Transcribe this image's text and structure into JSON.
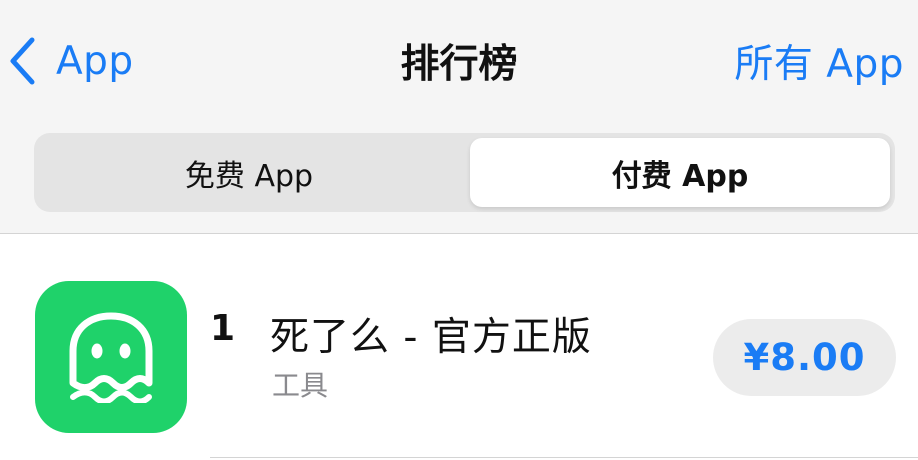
{
  "nav": {
    "back_label": "App",
    "title": "排行榜",
    "right_label": "所有 App"
  },
  "segments": {
    "free_label": "免费 App",
    "paid_label": "付费 App",
    "selected": "paid"
  },
  "list": [
    {
      "rank": "1",
      "name": "死了么 - 官方正版",
      "category": "工具",
      "price": "¥8.00",
      "icon": "ghost-icon"
    }
  ],
  "colors": {
    "accent": "#1a7cf5",
    "icon_bg": "#1fd26a",
    "header_bg": "#f5f5f5"
  }
}
